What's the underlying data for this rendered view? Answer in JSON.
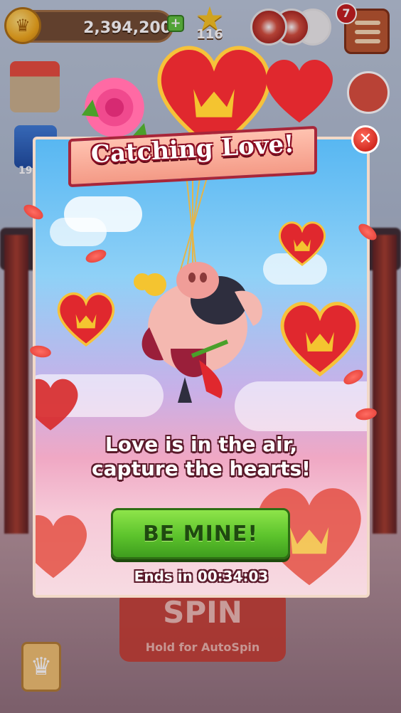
{
  "hud": {
    "coins": "2,394,200",
    "stars": "116",
    "notifications": "7",
    "side_counter": "19"
  },
  "background": {
    "spin_label": "SPIN",
    "spin_sub": "Hold for AutoSpin"
  },
  "popup": {
    "title": "Catching Love!",
    "headline_line1": "Love is in the air,",
    "headline_line2": "capture the hearts!",
    "cta_label": "BE MINE!",
    "timer_text": "Ends in 00:34:03",
    "close_symbol": "✕"
  },
  "icons": {
    "coin": "crown-coin-icon",
    "star": "star-icon",
    "menu": "hamburger-menu-icon",
    "close": "close-icon"
  },
  "colors": {
    "cta_green": "#5cc32c",
    "banner_red": "#a8263a",
    "heart_red": "#e0282e",
    "gold": "#f4c430"
  }
}
